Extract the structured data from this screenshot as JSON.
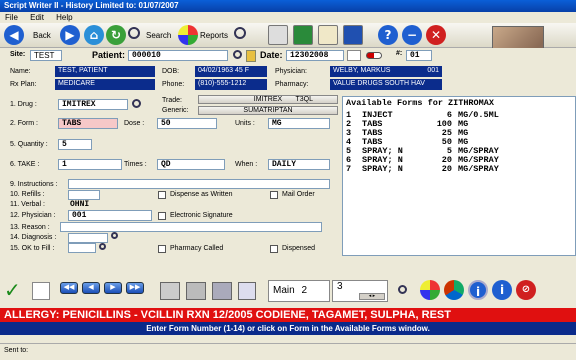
{
  "window": {
    "title": "Script Writer II - History Limited to: 01/07/2007"
  },
  "menu": [
    "File",
    "Edit",
    "Help"
  ],
  "toolbar": {
    "back_label": "Back",
    "search_label": "Search",
    "reports_label": "Reports"
  },
  "header": {
    "site_label": "Site:",
    "site_value": "TEST",
    "patient_label": "Patient:",
    "patient_value": "000010",
    "date_label": "Date:",
    "date_value": "12302008",
    "num_label": "#:",
    "num_value": "01"
  },
  "patient": {
    "name_label": "Name:",
    "name_value": "TEST, PATIENT",
    "rxplan_label": "Rx Plan:",
    "rxplan_value": "MEDICARE",
    "dob_label": "DOB:",
    "dob_value": "04/02/1963  45 F",
    "phone_label": "Phone:",
    "phone_value": "(810)-555-1212",
    "physician_label": "Physician:",
    "physician_value": "WELBY, MARKUS",
    "physician_code": "001",
    "pharmacy_label": "Pharmacy:",
    "pharmacy_value": "VALUE DRUGS SOUTH HAV"
  },
  "rx": {
    "drug_label": "1. Drug :",
    "drug_value": "IMITREX",
    "trade_label": "Trade:",
    "trade_value": "IMITREX",
    "trade_suffix": "T3QL",
    "generic_label": "Generic:",
    "generic_value": "SUMATRIPTAN",
    "form_label": "2. Form :",
    "form_value": "TABS",
    "dose_label": "Dose :",
    "dose_value": "50",
    "units_label": "Units :",
    "units_value": "MG",
    "quantity_label": "5. Quantity :",
    "quantity_value": "5",
    "take_label": "6. TAKE :",
    "take_value": "1",
    "times_label": "Times :",
    "times_value": "QD",
    "when_label": "When :",
    "when_value": "DAILY",
    "instructions_label": "9. Instructions :",
    "refills_label": "10. Refills :",
    "dispense_label": "Dispense as Written",
    "mailorder_label": "Mail Order",
    "verbal_label": "11. Verbal :",
    "verbal_value": "OHNI",
    "physician_label": "12. Physician :",
    "physician_value": "001",
    "esig_label": "Electronic Signature",
    "reason_label": "13. Reason :",
    "diagnosis_label": "14. Diagnosis :",
    "okfill_label": "15. OK to Fill :",
    "pharmacy_called_label": "Pharmacy Called",
    "dispensed_label": "Dispensed"
  },
  "available_forms": {
    "title": "Available Forms for ZITHROMAX",
    "rows": [
      {
        "n": "1",
        "form": "INJECT",
        "dose": "6",
        "units": "MG/0.5ML"
      },
      {
        "n": "2",
        "form": "TABS",
        "dose": "100",
        "units": "MG"
      },
      {
        "n": "3",
        "form": "TABS",
        "dose": "25",
        "units": "MG"
      },
      {
        "n": "4",
        "form": "TABS",
        "dose": "50",
        "units": "MG"
      },
      {
        "n": "5",
        "form": "SPRAY; N",
        "dose": "5",
        "units": "MG/SPRAY"
      },
      {
        "n": "6",
        "form": "SPRAY; N",
        "dose": "20",
        "units": "MG/SPRAY"
      },
      {
        "n": "7",
        "form": "SPRAY; N",
        "dose": "20",
        "units": "MG/SPRAY"
      }
    ]
  },
  "bottom": {
    "page_main": "Main",
    "page_2": "2",
    "page_3": "3"
  },
  "allergy": "ALLERGY: PENICILLINS - VCILLIN RXN 12/2005 CODIENE, TAGAMET, SULPHA, REST",
  "hint": "Enter Form Number (1-14) or click on Form in the Available Forms window.",
  "status": "Sent to:",
  "colors": {
    "accent_blue": "#0b2c8c",
    "allergy_red": "#e01010",
    "form_pink": "#f6c8c8"
  }
}
